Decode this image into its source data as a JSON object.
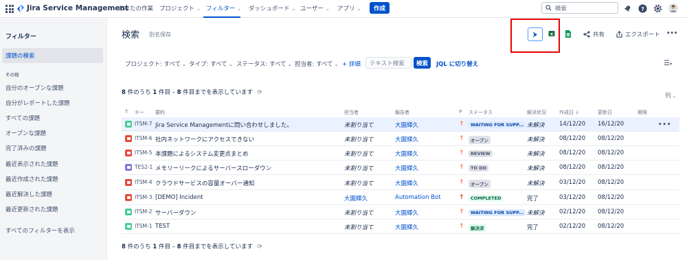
{
  "topnav": {
    "app_name": "Jira Service Management",
    "items": [
      {
        "label": "あなたの作業",
        "chev": false
      },
      {
        "label": "プロジェクト",
        "chev": true
      },
      {
        "label": "フィルター",
        "chev": true
      },
      {
        "label": "ダッシュボード",
        "chev": true
      },
      {
        "label": "ユーザー",
        "chev": true
      },
      {
        "label": "アプリ",
        "chev": true
      }
    ],
    "create_label": "作成",
    "search_placeholder": "検索"
  },
  "sidebar": {
    "title": "フィルター",
    "active_item": "課題の検索",
    "section_label": "その他",
    "items": [
      "自分のオープンな課題",
      "自分がレポートした課題",
      "すべての課題",
      "オープンな課題",
      "完了済みの課題",
      "最近表示された課題",
      "最近作成された課題",
      "最近解決した課題",
      "最近更新された課題"
    ],
    "view_all": "すべてのフィルターを表示"
  },
  "header": {
    "title": "検索",
    "save_as": "別名保存",
    "share": "共有",
    "export": "エクスポート",
    "more": "•••"
  },
  "filters": {
    "project": "プロジェクト: すべて",
    "type": "タイプ: すべて",
    "status": "ステータス: すべて",
    "assignee": "担当者: すべて",
    "more": "+ 詳細",
    "text_placeholder": "テキスト検索",
    "search_button": "検索",
    "jql": "JQL に切り替え"
  },
  "results": {
    "count_prefix": "8",
    "count_mid": " 件のうち ",
    "count_range": "1",
    "count_mid2": " 件目 – ",
    "count_end": "8",
    "count_suffix": " 件目までを表示しています",
    "columns_label": "列",
    "headers": {
      "t": "T",
      "key": "キー",
      "summary": "要約",
      "assignee": "担当者",
      "reporter": "報告者",
      "p": "P",
      "status": "ステータス",
      "resolution": "解決状況",
      "created": "作成日 ↓",
      "updated": "更新日",
      "due": "期限"
    }
  },
  "issues": [
    {
      "type_color": "#4bce97",
      "key": "ITSM-7",
      "summary": "Jira Service Managementに問い合わせしました。",
      "assignee": "未割り当て",
      "reporter": "大園輝久",
      "priority": "↑",
      "prio_color": "#ff7452",
      "status": "WAITING FOR SUPP...",
      "status_bg": "#deebff",
      "status_fg": "#0747a6",
      "resolution": "未解決",
      "created": "14/12/20",
      "updated": "16/12/20"
    },
    {
      "type_color": "#e5493a",
      "key": "ITSM-6",
      "summary": "社内ネットワークにアクセスできない",
      "assignee": "未割り当て",
      "reporter": "大園輝久",
      "priority": "↑",
      "prio_color": "#ff7452",
      "status": "オープン",
      "status_bg": "#dfe1e6",
      "status_fg": "#42526e",
      "resolution": "未解決",
      "created": "08/12/20",
      "updated": "08/12/20"
    },
    {
      "type_color": "#e5493a",
      "key": "ITSM-5",
      "summary": "本課題によるシステム変更点まとめ",
      "assignee": "未割り当て",
      "reporter": "大園輝久",
      "priority": "↑",
      "prio_color": "#ff7452",
      "status": "REVIEW",
      "status_bg": "#dfe1e6",
      "status_fg": "#42526e",
      "resolution": "未解決",
      "created": "08/12/20",
      "updated": "08/12/20"
    },
    {
      "type_color": "#8777d9",
      "key": "TES2-1",
      "summary": "メモリーリークによるサーバースローダウン",
      "assignee": "未割り当て",
      "reporter": "大園輝久",
      "priority": "↑",
      "prio_color": "#ff7452",
      "status": "TO DO",
      "status_bg": "#dfe1e6",
      "status_fg": "#42526e",
      "resolution": "未解決",
      "created": "08/12/20",
      "updated": "08/12/20"
    },
    {
      "type_color": "#e5493a",
      "key": "ITSM-4",
      "summary": "クラウドサービスの容量オーバー通知",
      "assignee": "未割り当て",
      "reporter": "大園輝久",
      "priority": "↑",
      "prio_color": "#ff7452",
      "status": "オープン",
      "status_bg": "#dfe1e6",
      "status_fg": "#42526e",
      "resolution": "未解決",
      "created": "03/12/20",
      "updated": "08/12/20"
    },
    {
      "type_color": "#e5493a",
      "key": "ITSM-3",
      "summary": "[DEMO] Incident",
      "assignee": "大園輝久",
      "reporter": "Automation Bot",
      "priority": "↑",
      "prio_color": "#de350b",
      "status": "COMPLETED",
      "status_bg": "#e3fcef",
      "status_fg": "#006644",
      "resolution": "完了",
      "created": "03/12/20",
      "updated": "08/12/20"
    },
    {
      "type_color": "#4bce97",
      "key": "ITSM-2",
      "summary": "サーバーダウン",
      "assignee": "未割り当て",
      "reporter": "大園輝久",
      "priority": "↑",
      "prio_color": "#ff7452",
      "status": "WAITING FOR SUPP...",
      "status_bg": "#deebff",
      "status_fg": "#0747a6",
      "resolution": "未解決",
      "created": "02/12/20",
      "updated": "08/12/20"
    },
    {
      "type_color": "#4bce97",
      "key": "ITSM-1",
      "summary": "TEST",
      "assignee": "未割り当て",
      "reporter": "大園輝久",
      "priority": "↑",
      "prio_color": "#ff7452",
      "status": "解決済",
      "status_bg": "#e3fcef",
      "status_fg": "#006644",
      "resolution": "完了",
      "created": "02/12/20",
      "updated": "08/12/20"
    }
  ],
  "row_more": "•••",
  "colors": {
    "brand": "#0052cc",
    "highlight_box": "#e30000"
  }
}
